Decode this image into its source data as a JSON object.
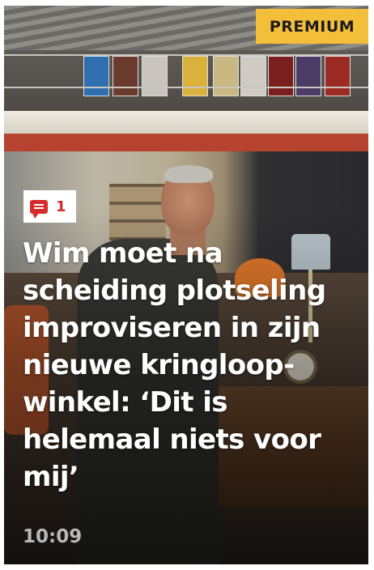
{
  "badge": {
    "label": "PREMIUM"
  },
  "comments": {
    "count": "1",
    "icon": "comment-icon"
  },
  "article": {
    "headline": "Wim moet na scheiding plotseling improviseren in zijn nieuwe kringloop-winkel: ‘Dit is helemaal niets voor mij’",
    "time": "10:09"
  },
  "colors": {
    "premium": "#f3bf3b",
    "comment_red": "#d82b2b",
    "headline": "#ffffff",
    "time": "#b8b8b8"
  }
}
